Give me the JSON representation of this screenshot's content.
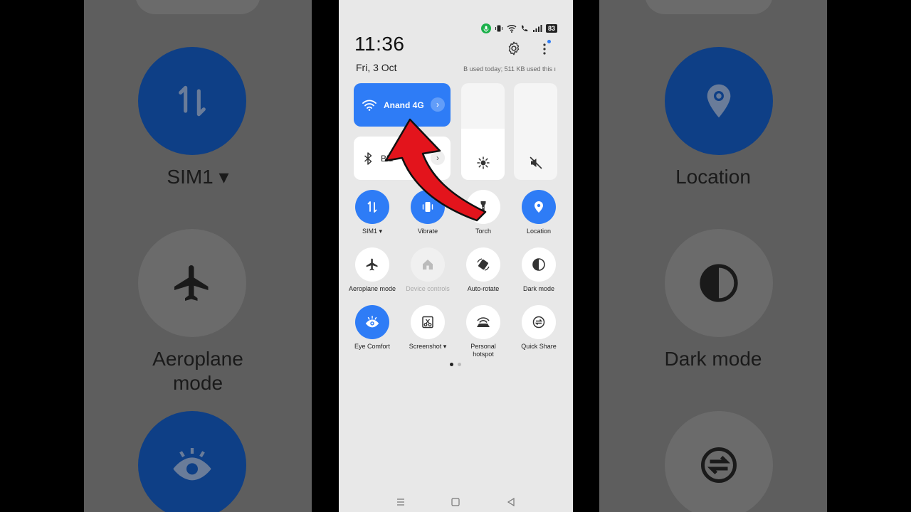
{
  "background": {
    "left": {
      "sim_label": "SIM1 ▾",
      "aeroplane_label": "Aeroplane\nmode"
    },
    "right": {
      "location_label": "Location",
      "dark_mode_label": "Dark mode"
    }
  },
  "status_bar": {
    "battery": "83"
  },
  "header": {
    "time": "11:36",
    "date": "Fri, 3 Oct",
    "data_usage": "B used today; 511 KB used this ı"
  },
  "tiles": {
    "wifi": {
      "label": "Anand 4G",
      "chevron": "›"
    },
    "bluetooth": {
      "label": "Blu",
      "chevron": "›"
    }
  },
  "quick_settings": [
    {
      "label": "SIM1 ▾",
      "state": "on"
    },
    {
      "label": "Vibrate",
      "state": "on"
    },
    {
      "label": "Torch",
      "state": "off"
    },
    {
      "label": "Location",
      "state": "on"
    },
    {
      "label": "Aeroplane mode",
      "state": "off"
    },
    {
      "label": "Device controls",
      "state": "disabled"
    },
    {
      "label": "Auto-rotate",
      "state": "off"
    },
    {
      "label": "Dark mode",
      "state": "off"
    },
    {
      "label": "Eye Comfort",
      "state": "on"
    },
    {
      "label": "Screenshot ▾",
      "state": "off"
    },
    {
      "label": "Personal hotspot",
      "state": "off"
    },
    {
      "label": "Quick Share",
      "state": "off"
    }
  ],
  "colors": {
    "accent": "#2e7cf6",
    "arrow": "#e3141c",
    "panel": "#e8e8e8"
  }
}
